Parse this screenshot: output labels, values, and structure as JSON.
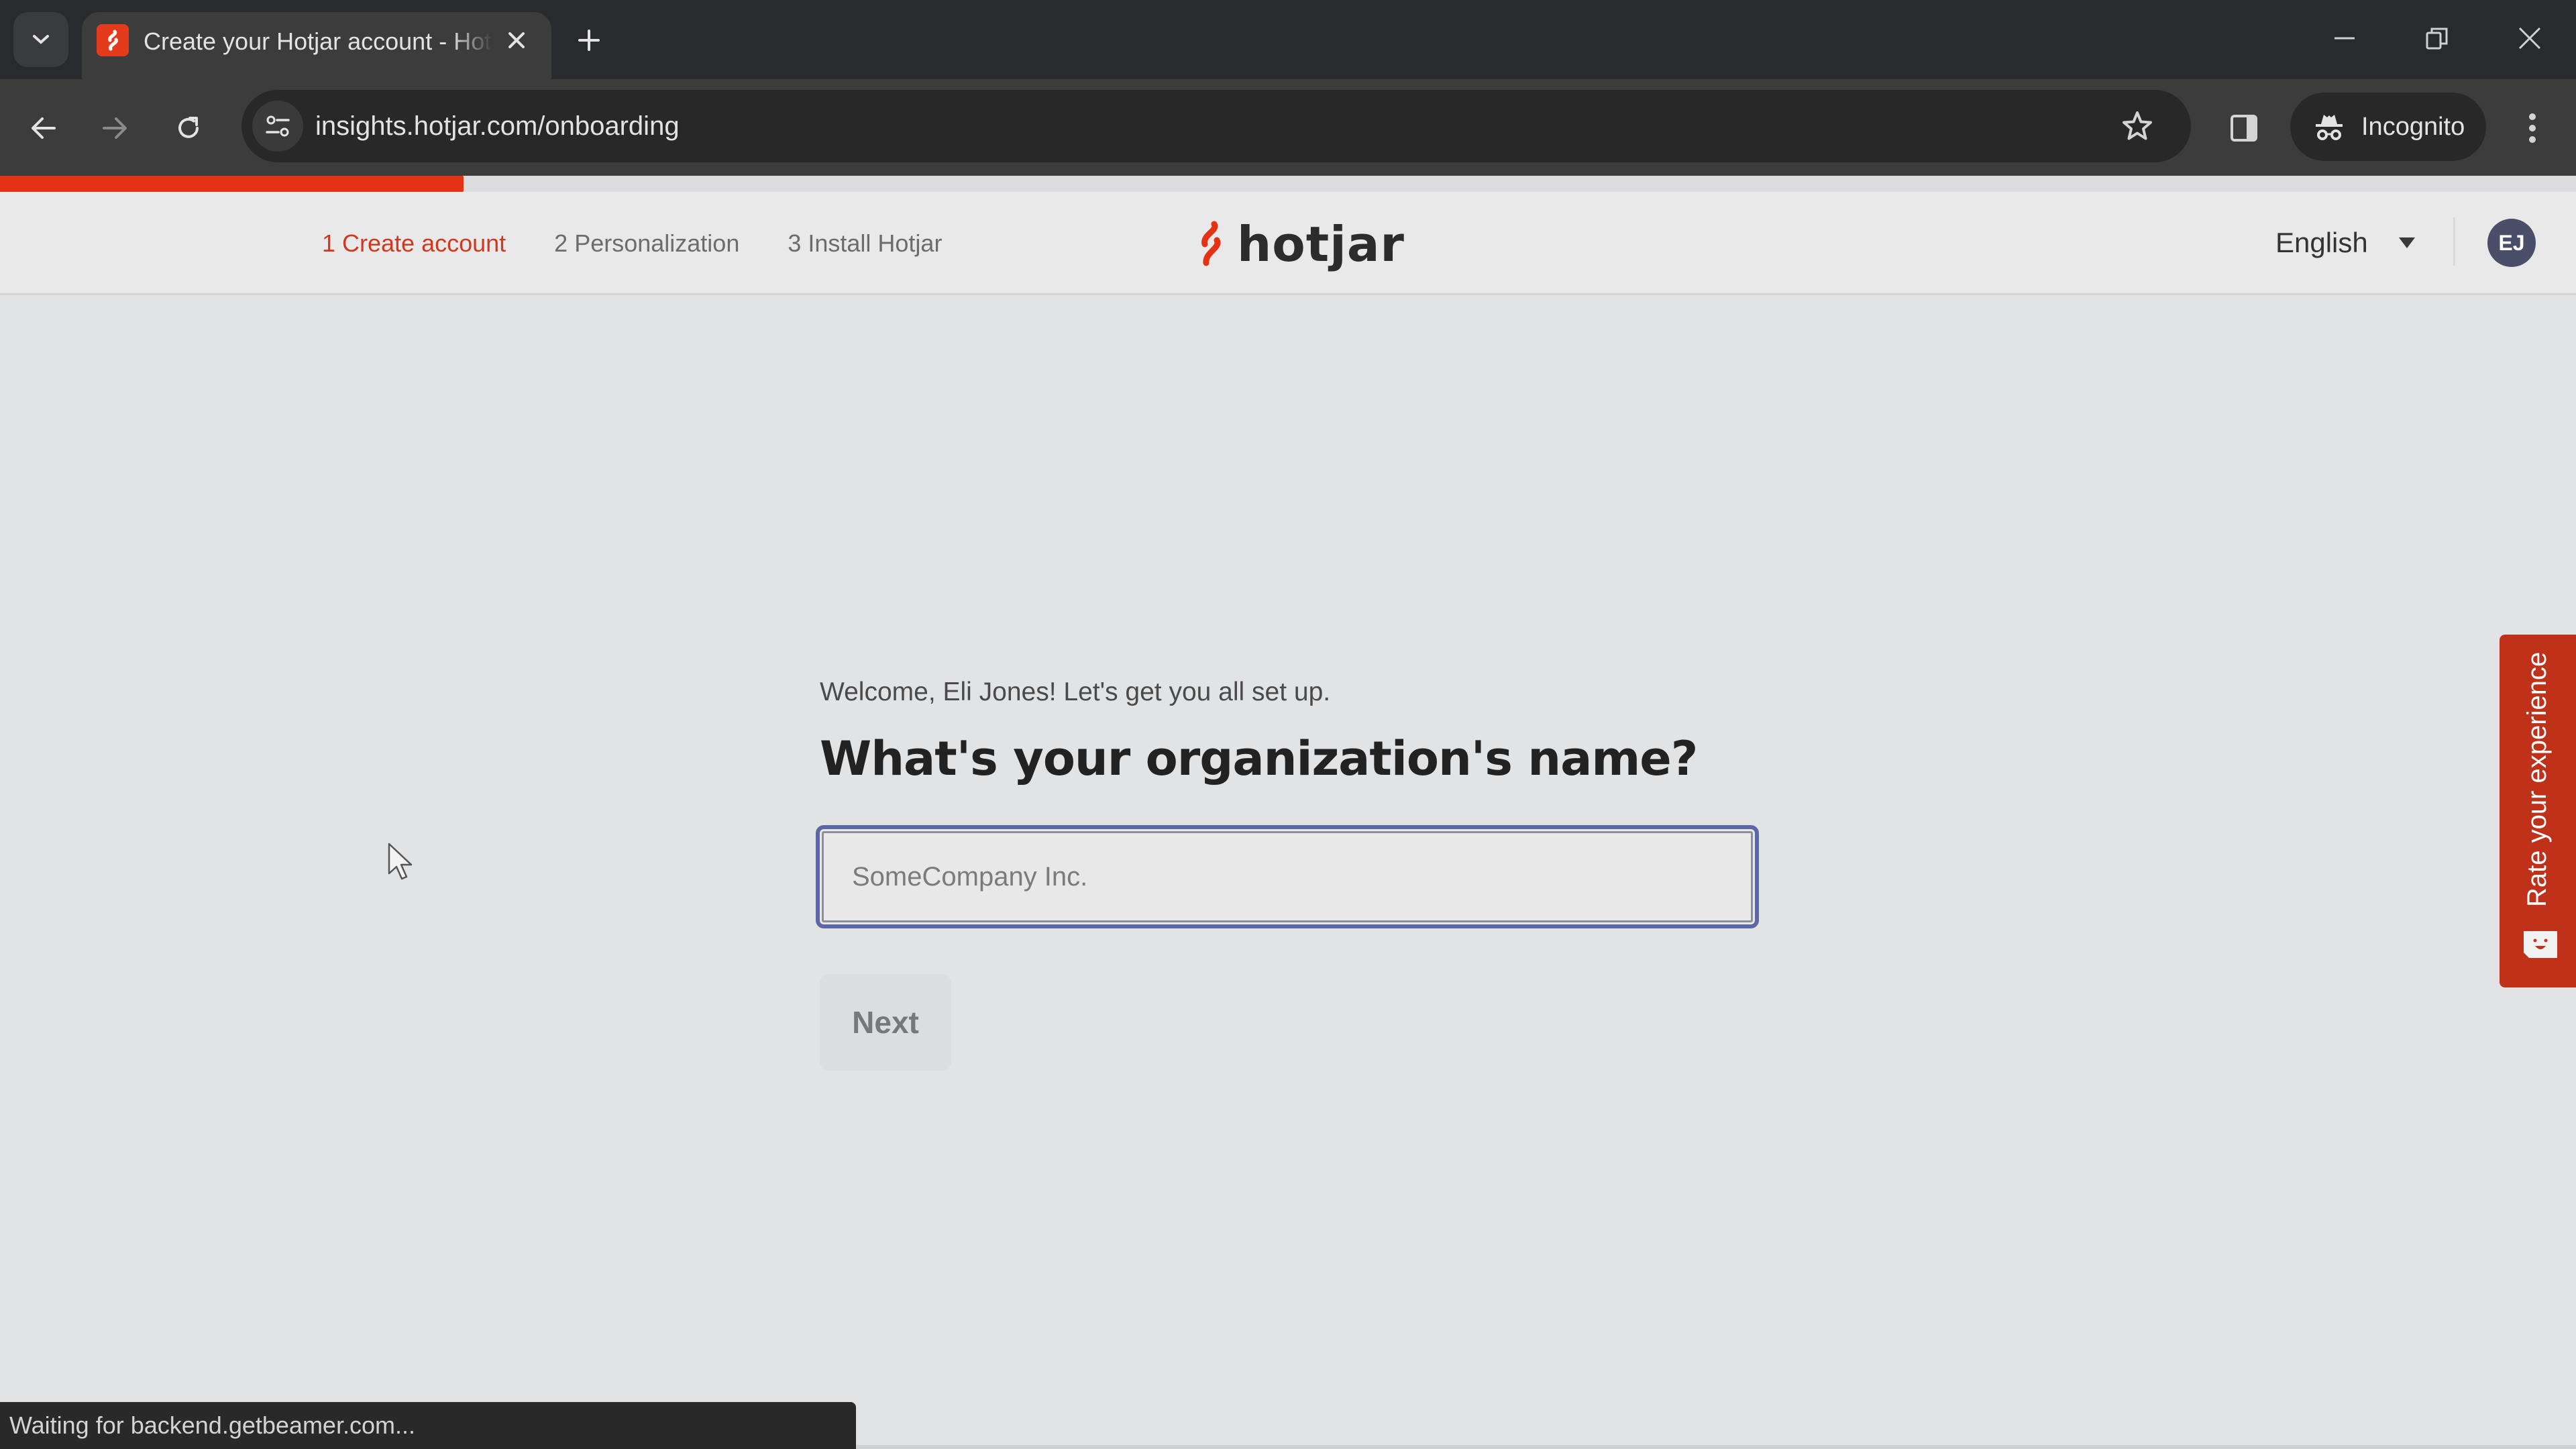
{
  "browser": {
    "tab": {
      "title": "Create your Hotjar account - Hotjar",
      "favicon": "hotjar-logo-icon"
    },
    "address_bar": {
      "url": "insights.hotjar.com/onboarding"
    },
    "incognito_label": "Incognito",
    "status_text": "Waiting for backend.getbeamer.com..."
  },
  "onboarding": {
    "progress_percent": 18,
    "steps": [
      {
        "label": "1 Create account",
        "active": true
      },
      {
        "label": "2 Personalization",
        "active": false
      },
      {
        "label": "3 Install Hotjar",
        "active": false
      }
    ]
  },
  "header": {
    "logo_text": "hotjar",
    "language": "English",
    "avatar_initials": "EJ"
  },
  "main": {
    "welcome": "Welcome, Eli Jones! Let's get you all set up.",
    "question": "What's your organization's name?",
    "org_input": {
      "value": "",
      "placeholder": "SomeCompany Inc."
    },
    "next_label": "Next"
  },
  "feedback_widget": {
    "label": "Rate your experience"
  },
  "colors": {
    "brand": "#e43314",
    "active_step": "#d0391f",
    "input_focus": "#5c67a5",
    "feedback_bg": "#bf3119",
    "avatar_bg": "#4a4e69"
  }
}
